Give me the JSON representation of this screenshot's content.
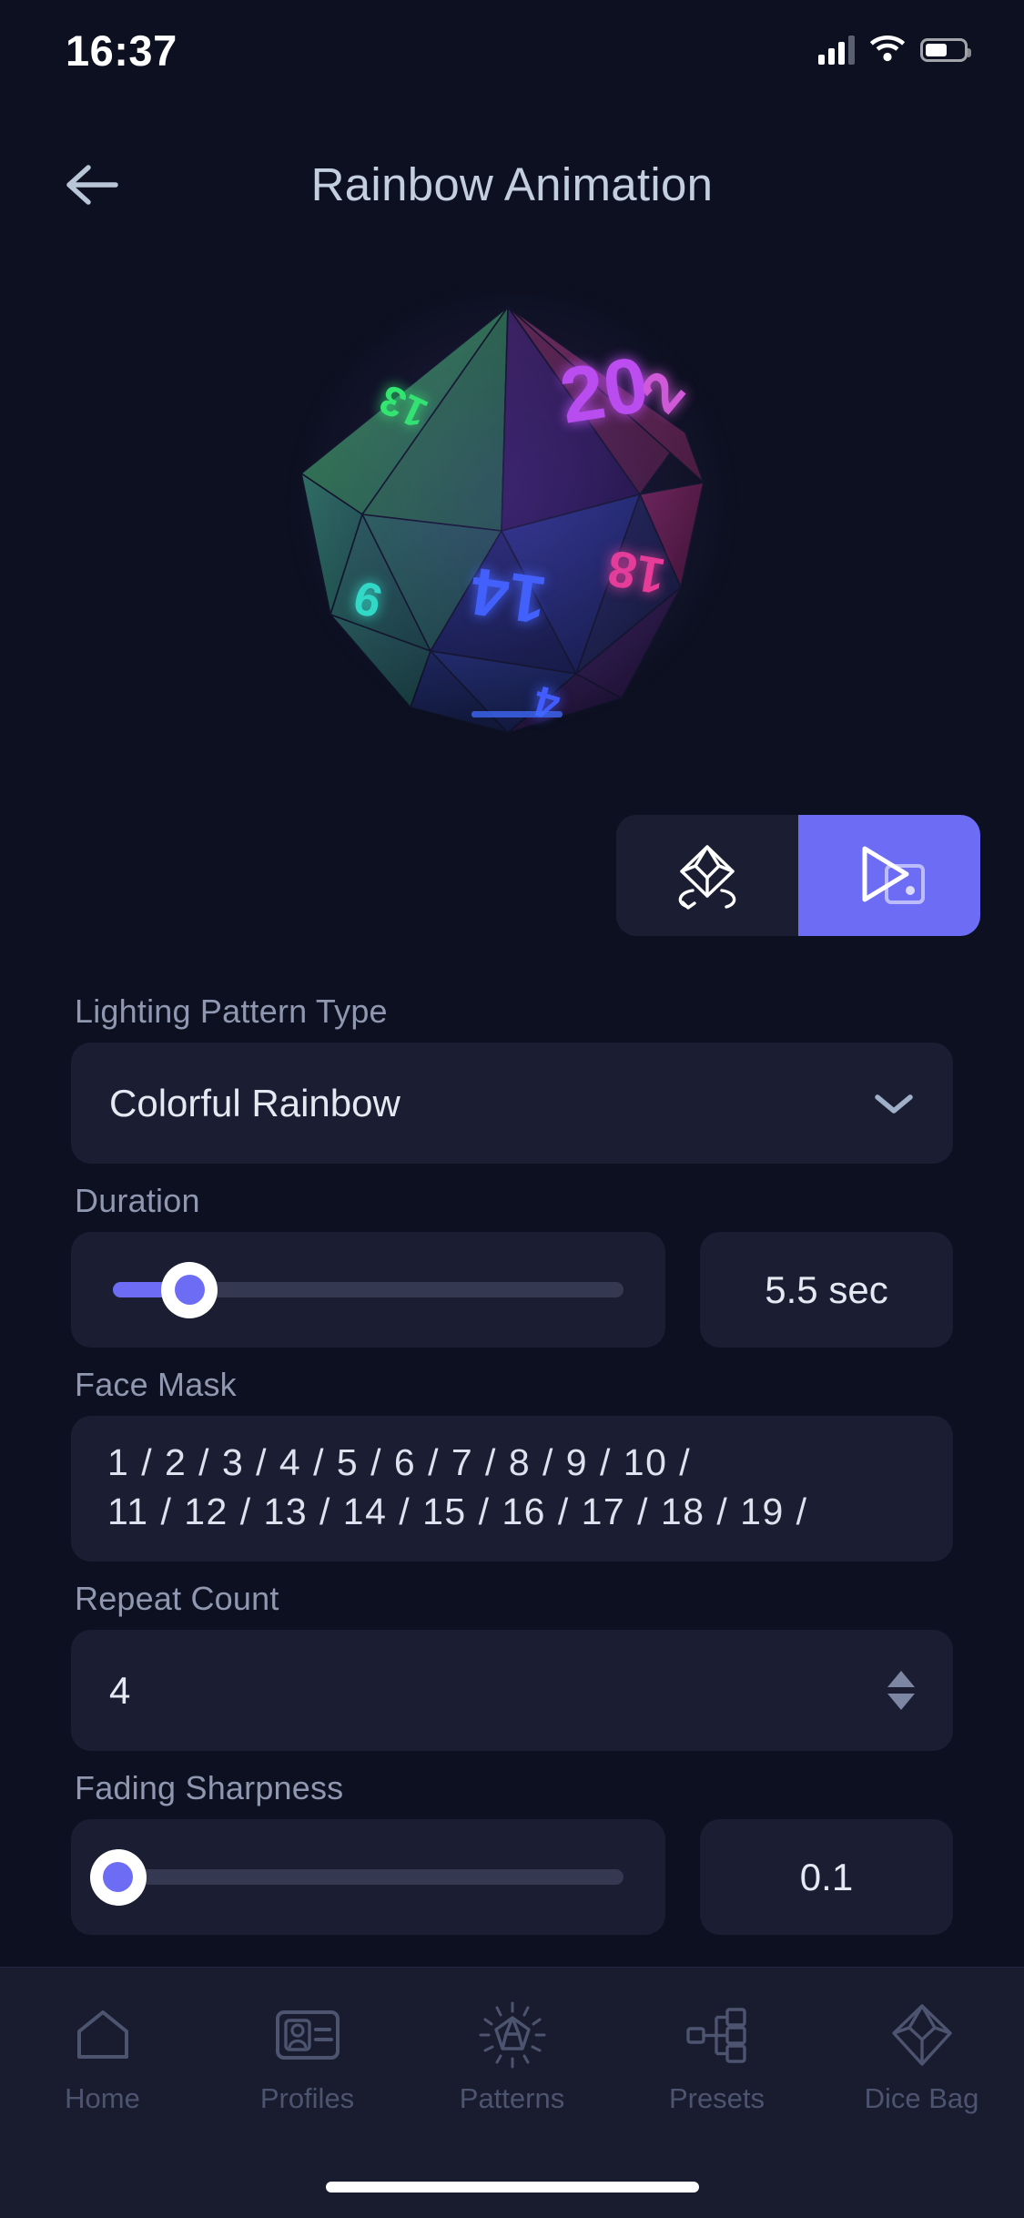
{
  "status_bar": {
    "time": "16:37",
    "signal_icon": "cellular-signal-icon",
    "wifi_icon": "wifi-icon",
    "battery_icon": "battery-icon"
  },
  "header": {
    "back_icon": "arrow-left-icon",
    "title": "Rainbow Animation"
  },
  "die_preview": {
    "die_type": "d20-icosahedron",
    "visible_face_numbers": [
      "20",
      "2",
      "14",
      "9",
      "18"
    ],
    "face_colors": {
      "top_left": "#2ecc71",
      "top_center": "#b84ff0",
      "top_right": "#c94bb8",
      "center_left": "#3b5fe0",
      "center_right": "#2b3a8a",
      "bottom_left": "#2fd6c0",
      "bottom_center": "#3d4be8",
      "bottom_right": "#e0338f"
    }
  },
  "view_buttons": [
    {
      "name": "rotate-die-button",
      "icon": "rotate-die-icon",
      "active": false
    },
    {
      "name": "play-animation-button",
      "icon": "play-preview-icon",
      "active": true
    }
  ],
  "form": {
    "pattern_type": {
      "label": "Lighting Pattern Type",
      "value": "Colorful Rainbow",
      "chevron_icon": "chevron-down-icon"
    },
    "duration": {
      "label": "Duration",
      "value": "5.5 sec",
      "slider_percent": 15
    },
    "face_mask": {
      "label": "Face Mask",
      "line1": "1 / 2 / 3 / 4 / 5 / 6 / 7 / 8 / 9 / 10 /",
      "line2": "11 / 12 / 13 / 14 / 15 / 16 / 17 / 18 / 19 /"
    },
    "repeat_count": {
      "label": "Repeat Count",
      "value": "4",
      "stepper_icon": "up-down-stepper-icon"
    },
    "fading_sharpness": {
      "label": "Fading Sharpness",
      "value": "0.1",
      "slider_percent": 1
    }
  },
  "tabbar": [
    {
      "label": "Home",
      "icon": "home-icon"
    },
    {
      "label": "Profiles",
      "icon": "id-card-icon"
    },
    {
      "label": "Patterns",
      "icon": "radiant-die-icon"
    },
    {
      "label": "Presets",
      "icon": "hierarchy-tree-icon"
    },
    {
      "label": "Dice Bag",
      "icon": "octahedron-die-icon"
    }
  ],
  "colors": {
    "page_background": "#0d1020",
    "card_background": "#1b1e33",
    "accent": "#6c6cf5",
    "label_text": "#8f98b0",
    "value_text": "#e4e9f2",
    "tabbar_background": "#181c2e",
    "tab_inactive": "#4d5470"
  }
}
